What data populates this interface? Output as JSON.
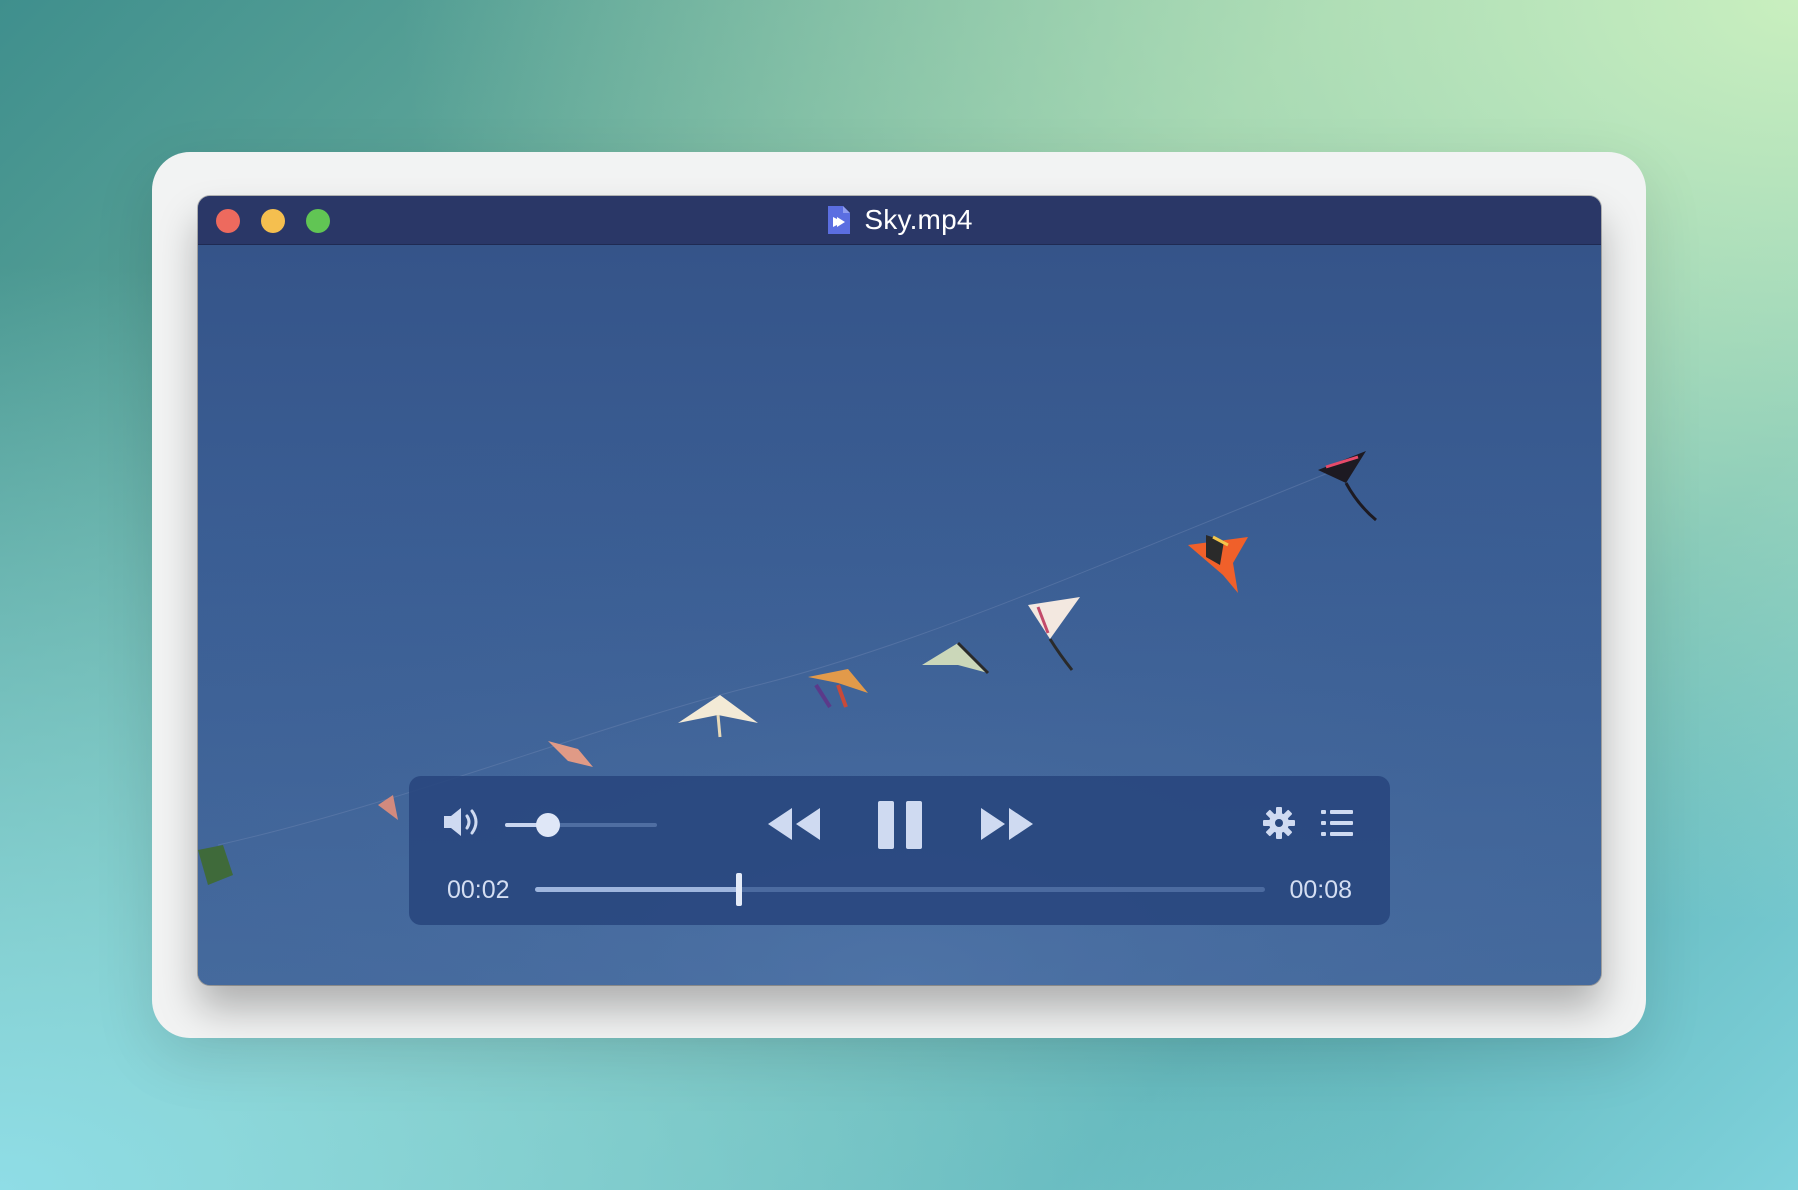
{
  "window": {
    "title": "Sky.mp4",
    "file_icon": "video-file-icon",
    "buttons": [
      "close",
      "minimize",
      "zoom"
    ]
  },
  "video": {
    "scene": "kites-in-blue-sky"
  },
  "controls": {
    "volume_icon": "speaker-icon",
    "volume_level": 0.28,
    "rewind_icon": "rewind-icon",
    "pause_icon": "pause-icon",
    "fast_forward_icon": "fast-forward-icon",
    "settings_icon": "gear-icon",
    "playlist_icon": "list-icon",
    "current_time": "00:02",
    "duration": "00:08",
    "progress": 0.28
  },
  "colors": {
    "titlebar": "#2a3767",
    "close": "#ed6a5e",
    "minimize": "#f5bf4f",
    "zoom": "#61c554",
    "accent": "#5b6ee1"
  }
}
